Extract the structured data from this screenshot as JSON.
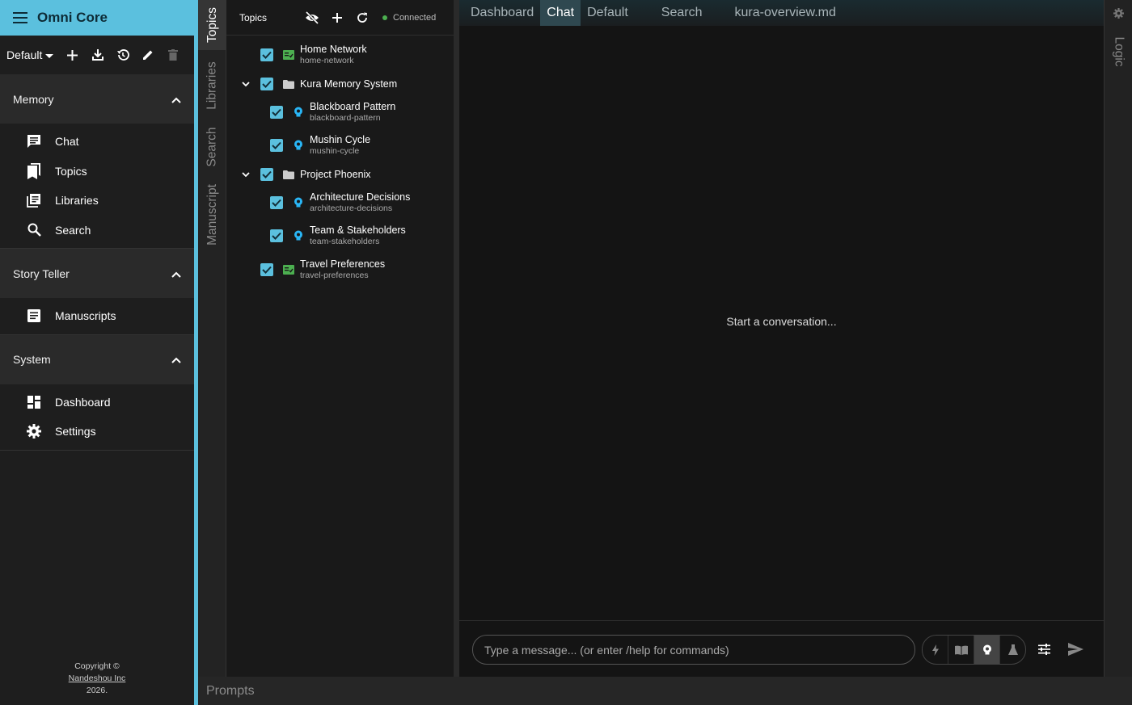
{
  "app": {
    "title": "Omni Core"
  },
  "profile": {
    "name": "Default"
  },
  "sidebar": {
    "sections": [
      {
        "title": "Memory",
        "items": [
          {
            "label": "Chat",
            "icon": "chat-icon"
          },
          {
            "label": "Topics",
            "icon": "bookmarks-icon"
          },
          {
            "label": "Libraries",
            "icon": "library-icon"
          },
          {
            "label": "Search",
            "icon": "search-icon"
          }
        ]
      },
      {
        "title": "Story Teller",
        "items": [
          {
            "label": "Manuscripts",
            "icon": "article-icon"
          }
        ]
      },
      {
        "title": "System",
        "items": [
          {
            "label": "Dashboard",
            "icon": "dashboard-icon"
          },
          {
            "label": "Settings",
            "icon": "gear-icon"
          }
        ]
      }
    ],
    "copyright": {
      "line1": "Copyright ©",
      "link": "Nandeshou Inc",
      "year": "2026."
    }
  },
  "vertical_tabs": [
    "Topics",
    "Libraries",
    "Search",
    "Manuscript"
  ],
  "topics_panel": {
    "title": "Topics",
    "status": "Connected",
    "items": [
      {
        "name": "Home Network",
        "slug": "home-network",
        "type": "note"
      },
      {
        "name": "Kura Memory System",
        "type": "folder"
      },
      {
        "name": "Blackboard Pattern",
        "slug": "blackboard-pattern",
        "type": "idea"
      },
      {
        "name": "Mushin Cycle",
        "slug": "mushin-cycle",
        "type": "idea"
      },
      {
        "name": "Project Phoenix",
        "type": "folder"
      },
      {
        "name": "Architecture Decisions",
        "slug": "architecture-decisions",
        "type": "idea"
      },
      {
        "name": "Team & Stakeholders",
        "slug": "team-stakeholders",
        "type": "idea"
      },
      {
        "name": "Travel Preferences",
        "slug": "travel-preferences",
        "type": "note"
      }
    ]
  },
  "main_tabs": [
    "Dashboard",
    "Chat",
    "Default",
    "Search",
    "kura-overview.md"
  ],
  "main_tab_active": "Chat",
  "chat": {
    "empty_message": "Start a conversation...",
    "input_placeholder": "Type a message... (or enter /help for commands)"
  },
  "right_rail": {
    "tab": "Logic"
  },
  "bottom_bar": {
    "label": "Prompts"
  },
  "colors": {
    "accent": "#5bc0de",
    "note_icon": "#4caf50",
    "idea_icon": "#29b6f6",
    "status_dot": "#4caf50"
  }
}
